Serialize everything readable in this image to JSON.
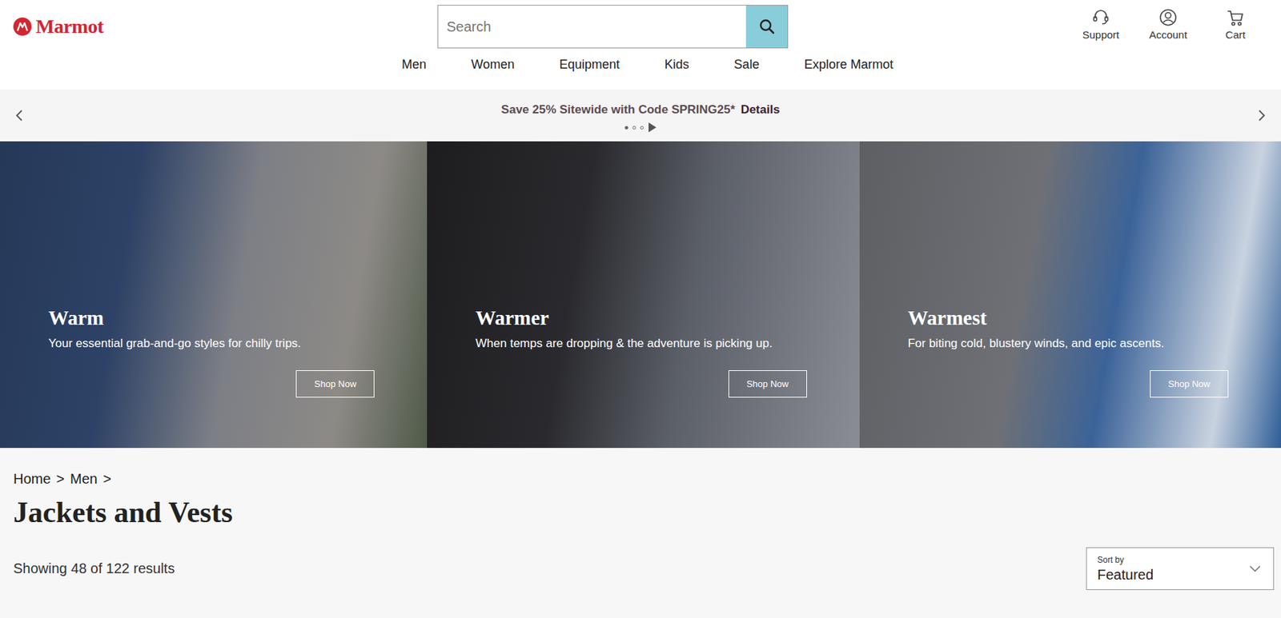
{
  "logo": {
    "text": "Marmot"
  },
  "search": {
    "placeholder": "Search"
  },
  "header_links": [
    {
      "label": "Support"
    },
    {
      "label": "Account"
    },
    {
      "label": "Cart"
    }
  ],
  "nav": [
    {
      "label": "Men"
    },
    {
      "label": "Women"
    },
    {
      "label": "Equipment"
    },
    {
      "label": "Kids"
    },
    {
      "label": "Sale"
    },
    {
      "label": "Explore Marmot"
    }
  ],
  "promo": {
    "text": "Save 25% Sitewide with Code SPRING25*",
    "link": "Details",
    "dots": [
      {
        "selected": true
      },
      {
        "selected": false
      },
      {
        "selected": false
      }
    ]
  },
  "hero": [
    {
      "title": "Warm",
      "subtitle": "Your essential grab-and-go styles for chilly trips.",
      "button": "Shop Now"
    },
    {
      "title": "Warmer",
      "subtitle": "When temps are dropping & the adventure is picking up.",
      "button": "Shop Now"
    },
    {
      "title": "Warmest",
      "subtitle": "For biting cold, blustery winds, and epic ascents.",
      "button": "Shop Now"
    }
  ],
  "breadcrumb": {
    "items": [
      {
        "label": "Home"
      },
      {
        "label": "Men"
      }
    ],
    "separator": ">"
  },
  "page_title": "Jackets and Vests",
  "results": "Showing 48 of 122 results",
  "sort": {
    "label": "Sort by",
    "value": "Featured"
  }
}
